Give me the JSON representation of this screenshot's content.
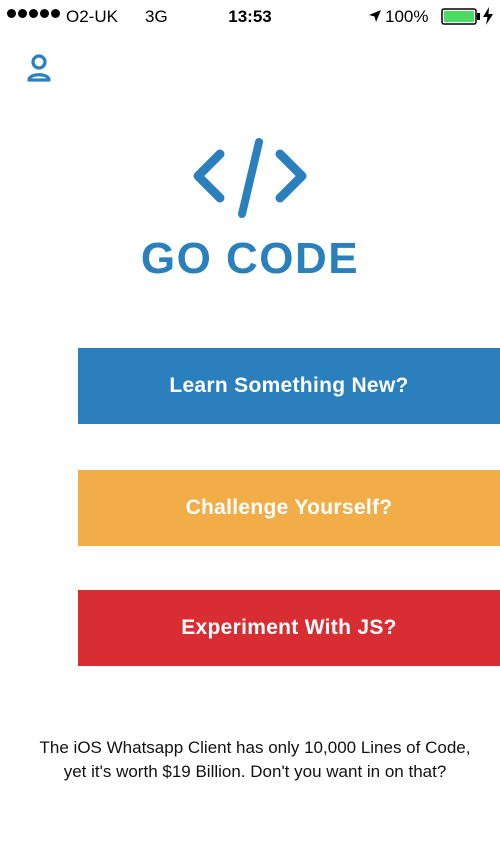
{
  "status_bar": {
    "carrier": "O2-UK",
    "network": "3G",
    "time": "13:53",
    "battery_percent": "100%",
    "icons": [
      "signal-dots-icon",
      "location-arrow-icon",
      "battery-icon",
      "charging-icon"
    ],
    "battery_color": "#4cd964"
  },
  "header": {
    "profile_icon": "profile-icon"
  },
  "logo": {
    "symbol_icon": "code-brackets-icon",
    "title": "GO CODE",
    "color": "#2a7fbd"
  },
  "menu": {
    "buttons": [
      {
        "label": "Learn Something New?",
        "color": "#2a7fbd"
      },
      {
        "label": "Challenge Yourself?",
        "color": "#f0ad48"
      },
      {
        "label": "Experiment With JS?",
        "color": "#d82d32"
      }
    ]
  },
  "footer": {
    "text": "The iOS Whatsapp Client has only 10,000 Lines of Code, yet it's worth $19 Billion. Don't you want in on that?"
  }
}
